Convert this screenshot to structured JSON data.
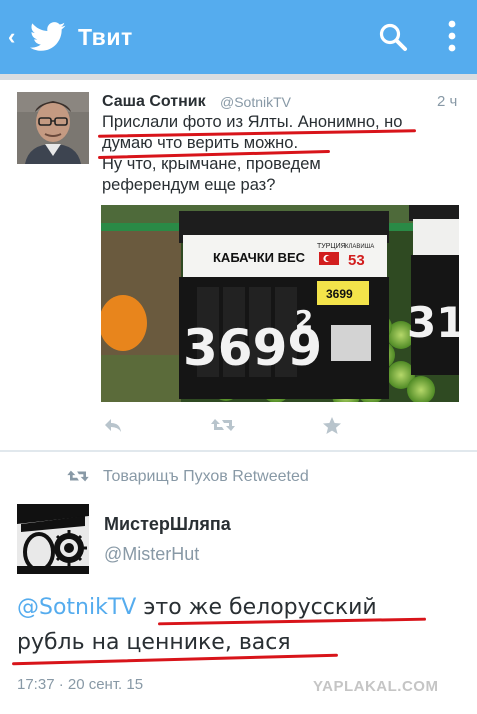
{
  "header": {
    "back_glyph": "‹",
    "title": "Твит",
    "bg_color": "#55acee"
  },
  "tweet": {
    "author_name": "Саша Сотник",
    "author_handle": "@SotnikTV",
    "time": "2 ч",
    "text_lines": [
      "Прислали фото из Ялты. Анонимно, но",
      "думаю что верить можно.",
      "Ну что, крымчане, проведем",
      "референдум еще раз?"
    ],
    "photo": {
      "sign_label": "КАБАЧКИ ВЕС",
      "origin": "ТУРЦИЯ",
      "origin_small": "КЛАВИША",
      "key_number": "53",
      "small_price": "3699",
      "price_main": "3699",
      "price_sup": "2",
      "right_sign": "31"
    },
    "actions": [
      "reply-icon",
      "retweet-icon",
      "favorite-icon"
    ]
  },
  "retweet": {
    "retweeted_by": "Товарищъ Пухов Retweeted",
    "author_name": "МистерШляпа",
    "author_handle": "@MisterHut",
    "mention": "@SotnikTV",
    "text_after_mention": " это же белорусский",
    "text_line2": "рубль на ценнике, вася",
    "timestamp": "17:37 · 20 сент. 15",
    "watermark": "YAPLAKAL.COM"
  },
  "colors": {
    "accent": "#55acee",
    "underline_red": "#d8141a",
    "muted": "#8899a6"
  }
}
